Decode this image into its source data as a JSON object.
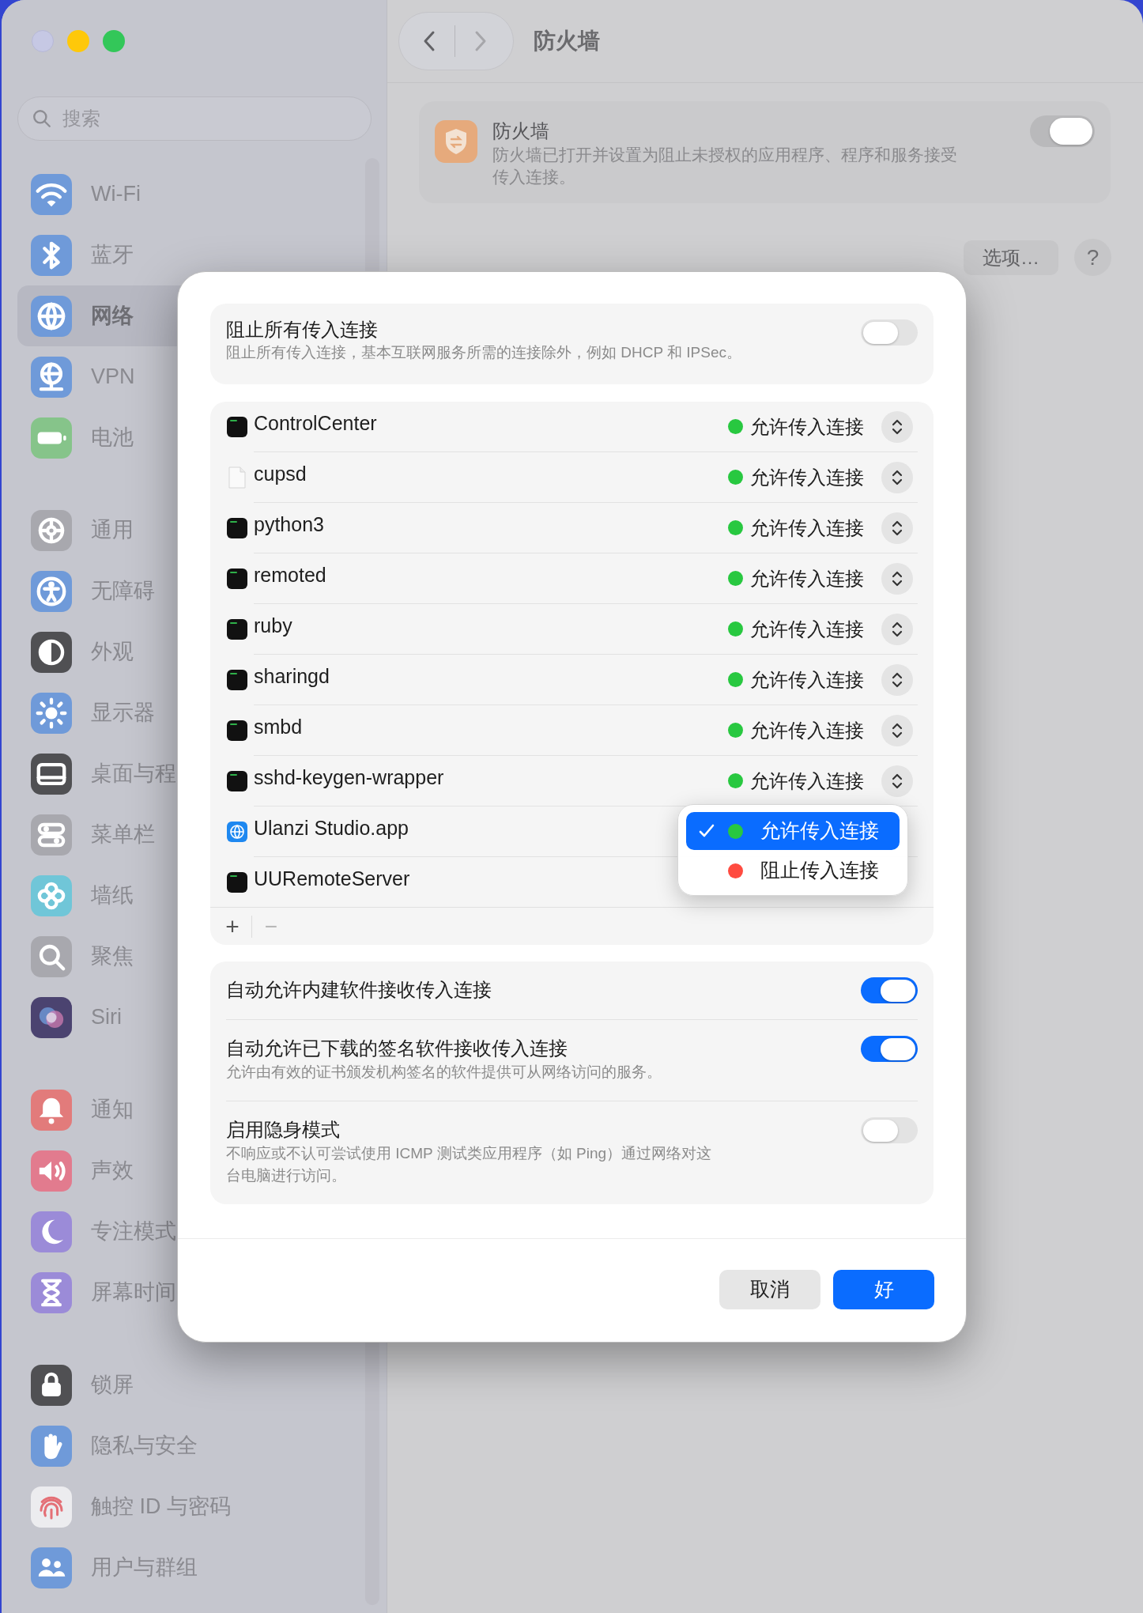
{
  "sidebar": {
    "search": {
      "placeholder": "搜索"
    },
    "groups": [
      {
        "items": [
          {
            "label": "Wi-Fi",
            "selected": false
          },
          {
            "label": "蓝牙",
            "selected": false
          },
          {
            "label": "网络",
            "selected": true
          },
          {
            "label": "VPN",
            "selected": false
          },
          {
            "label": "电池",
            "selected": false
          }
        ]
      },
      {
        "items": [
          {
            "label": "通用",
            "selected": false
          },
          {
            "label": "无障碍",
            "selected": false
          },
          {
            "label": "外观",
            "selected": false
          },
          {
            "label": "显示器",
            "selected": false
          },
          {
            "label": "桌面与程",
            "selected": false
          },
          {
            "label": "菜单栏",
            "selected": false
          },
          {
            "label": "墙纸",
            "selected": false
          },
          {
            "label": "聚焦",
            "selected": false
          },
          {
            "label": "Siri",
            "selected": false
          }
        ]
      },
      {
        "items": [
          {
            "label": "通知",
            "selected": false
          },
          {
            "label": "声效",
            "selected": false
          },
          {
            "label": "专注模式",
            "selected": false
          },
          {
            "label": "屏幕时间",
            "selected": false
          }
        ]
      },
      {
        "items": [
          {
            "label": "锁屏",
            "selected": false
          },
          {
            "label": "隐私与安全",
            "selected": false
          },
          {
            "label": "触控 ID 与密码",
            "selected": false
          },
          {
            "label": "用户与群组",
            "selected": false
          }
        ]
      }
    ]
  },
  "header": {
    "title": "防火墙"
  },
  "firewall": {
    "title": "防火墙",
    "description": "防火墙已打开并设置为阻止未授权的应用程序、程序和服务接受传入连接。",
    "on": true
  },
  "buttons": [
    "选项…",
    "?"
  ],
  "dialog": {
    "block_all": {
      "title": "阻止所有传入连接",
      "description": "阻止所有传入连接，基本互联网服务所需的连接除外，例如 DHCP 和 IPSec。",
      "on": false
    },
    "apps": [
      {
        "name": "ControlCenter",
        "kind": "exec",
        "status": {
          "label": "允许传入连接",
          "color": "#28c840"
        }
      },
      {
        "name": "cupsd",
        "kind": "document",
        "status": {
          "label": "允许传入连接",
          "color": "#28c840"
        }
      },
      {
        "name": "python3",
        "kind": "exec",
        "status": {
          "label": "允许传入连接",
          "color": "#28c840"
        }
      },
      {
        "name": "remoted",
        "kind": "exec",
        "status": {
          "label": "允许传入连接",
          "color": "#28c840"
        }
      },
      {
        "name": "ruby",
        "kind": "exec",
        "status": {
          "label": "允许传入连接",
          "color": "#28c840"
        }
      },
      {
        "name": "sharingd",
        "kind": "exec",
        "status": {
          "label": "允许传入连接",
          "color": "#28c840"
        }
      },
      {
        "name": "smbd",
        "kind": "exec",
        "status": {
          "label": "允许传入连接",
          "color": "#28c840"
        }
      },
      {
        "name": "sshd-keygen-wrapper",
        "kind": "exec",
        "status": {
          "label": "允许传入连接",
          "color": "#28c840"
        }
      },
      {
        "name": "Ulanzi Studio.app",
        "kind": "app"
      },
      {
        "name": "UURemoteServer",
        "kind": "exec"
      }
    ],
    "list_buttons": [
      "+",
      "−"
    ],
    "menu": [
      {
        "label": "允许传入连接",
        "color": "#28c840",
        "selected": true
      },
      {
        "label": "阻止传入连接",
        "color": "#ff4b40",
        "selected": false
      }
    ],
    "settings": [
      {
        "title": "自动允许内建软件接收传入连接",
        "on": true
      },
      {
        "title": "自动允许已下载的签名软件接收传入连接",
        "description": "允许由有效的证书颁发机构签名的软件提供可从网络访问的服务。",
        "on": true
      },
      {
        "title": "启用隐身模式",
        "description": "不响应或不认可尝试使用 ICMP 测试类应用程序（如 Ping）通过网络对这台电脑进行访问。",
        "on": false
      }
    ],
    "buttons": [
      {
        "label": "取消",
        "kind": "secondary"
      },
      {
        "label": "好",
        "kind": "primary"
      }
    ]
  }
}
